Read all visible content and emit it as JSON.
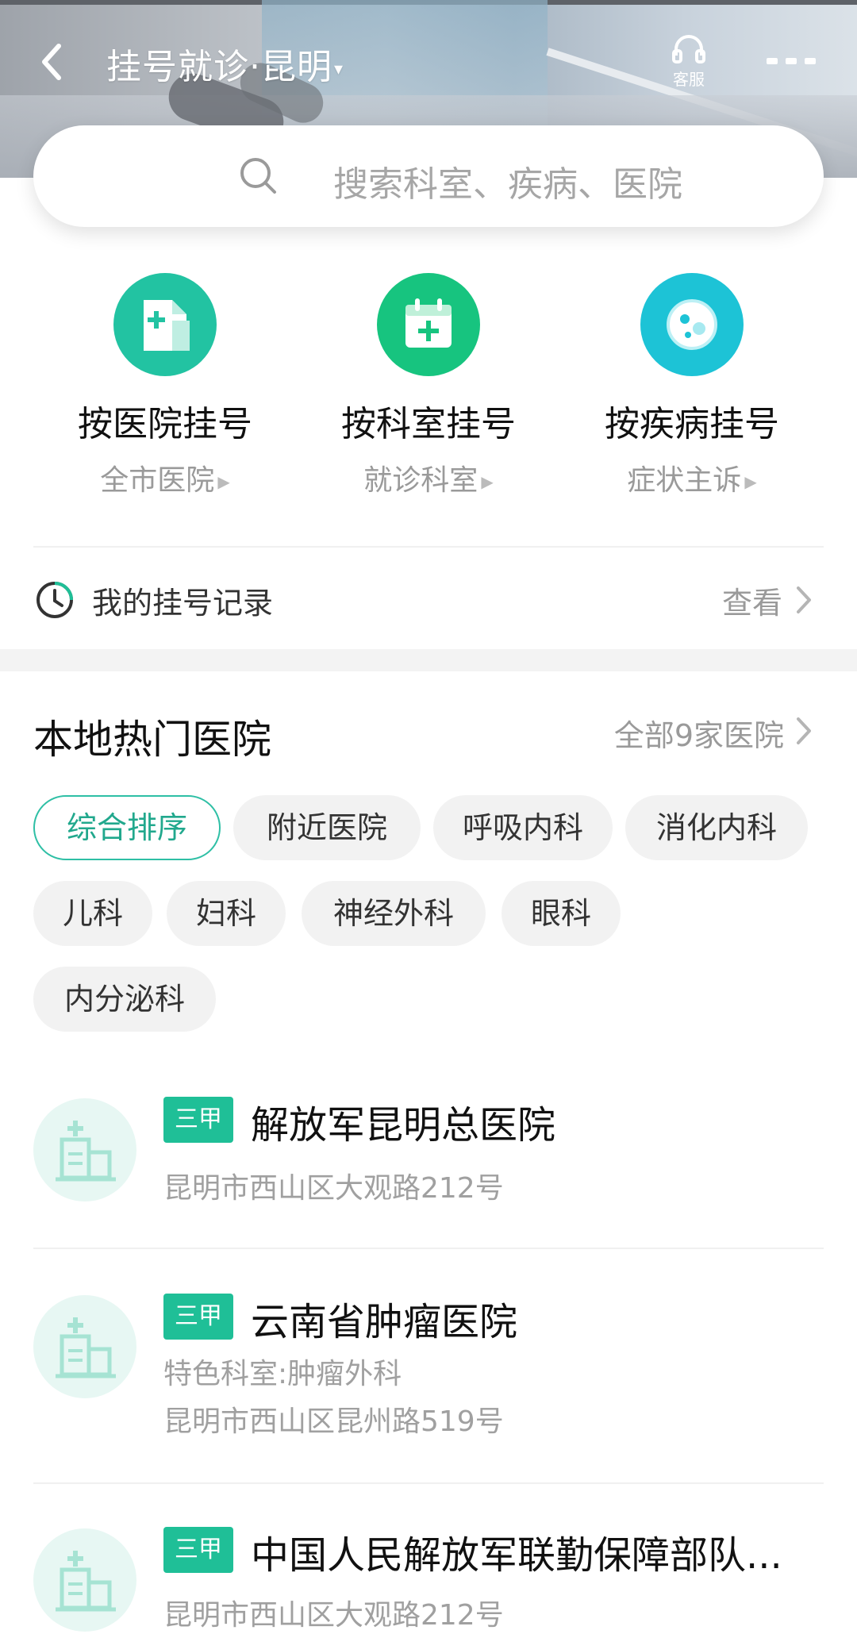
{
  "header": {
    "title": "挂号就诊·昆明",
    "caret": "▾",
    "service_label": "客服"
  },
  "search": {
    "placeholder": "搜索科室、疾病、医院"
  },
  "categories": [
    {
      "title": "按医院挂号",
      "sub": "全市医院",
      "color": "#22c3a2",
      "icon": "hospital-document-icon"
    },
    {
      "title": "按科室挂号",
      "sub": "就诊科室",
      "color": "#17c47f",
      "icon": "calendar-plus-icon"
    },
    {
      "title": "按疾病挂号",
      "sub": "症状主诉",
      "color": "#1dc3d6",
      "icon": "germ-icon"
    }
  ],
  "record": {
    "label": "我的挂号记录",
    "view": "查看"
  },
  "hot": {
    "title": "本地热门医院",
    "all": "全部9家医院",
    "chips": [
      "综合排序",
      "附近医院",
      "呼吸内科",
      "消化内科",
      "儿科",
      "妇科",
      "神经外科",
      "眼科",
      "内分泌科"
    ]
  },
  "hospitals": [
    {
      "badge": "三甲",
      "name": "解放军昆明总医院",
      "lines": [
        "昆明市西山区大观路212号"
      ]
    },
    {
      "badge": "三甲",
      "name": "云南省肿瘤医院",
      "lines": [
        "特色科室:肿瘤外科",
        "昆明市西山区昆州路519号"
      ]
    },
    {
      "badge": "三甲",
      "name": "中国人民解放军联勤保障部队...",
      "lines": [
        "昆明市西山区大观路212号"
      ]
    }
  ],
  "colors": {
    "accent": "#1fbf97",
    "chip_active": "#2ebfa5"
  }
}
